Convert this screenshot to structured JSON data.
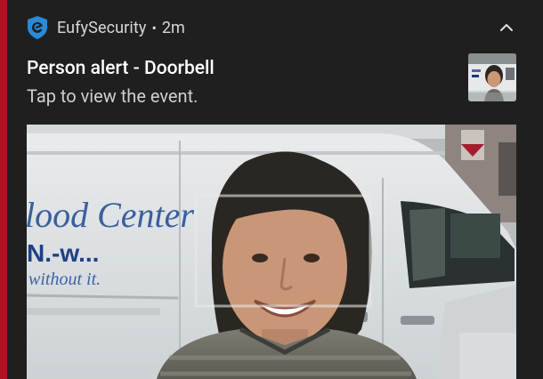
{
  "notification": {
    "app_name": "EufySecurity",
    "separator": "•",
    "time": "2m",
    "title": "Person alert - Doorbell",
    "body": "Tap to view the event.",
    "app_icon": "eufy-shield-icon",
    "collapse_icon": "chevron-up-icon"
  },
  "snapshot": {
    "van_text_line1": "lood Center",
    "van_text_line2": "N.-w...",
    "van_text_line3": "without it."
  },
  "colors": {
    "background_red": "#c0102a",
    "card_bg": "#1f1f1f",
    "eufy_blue": "#2a8ad8"
  }
}
